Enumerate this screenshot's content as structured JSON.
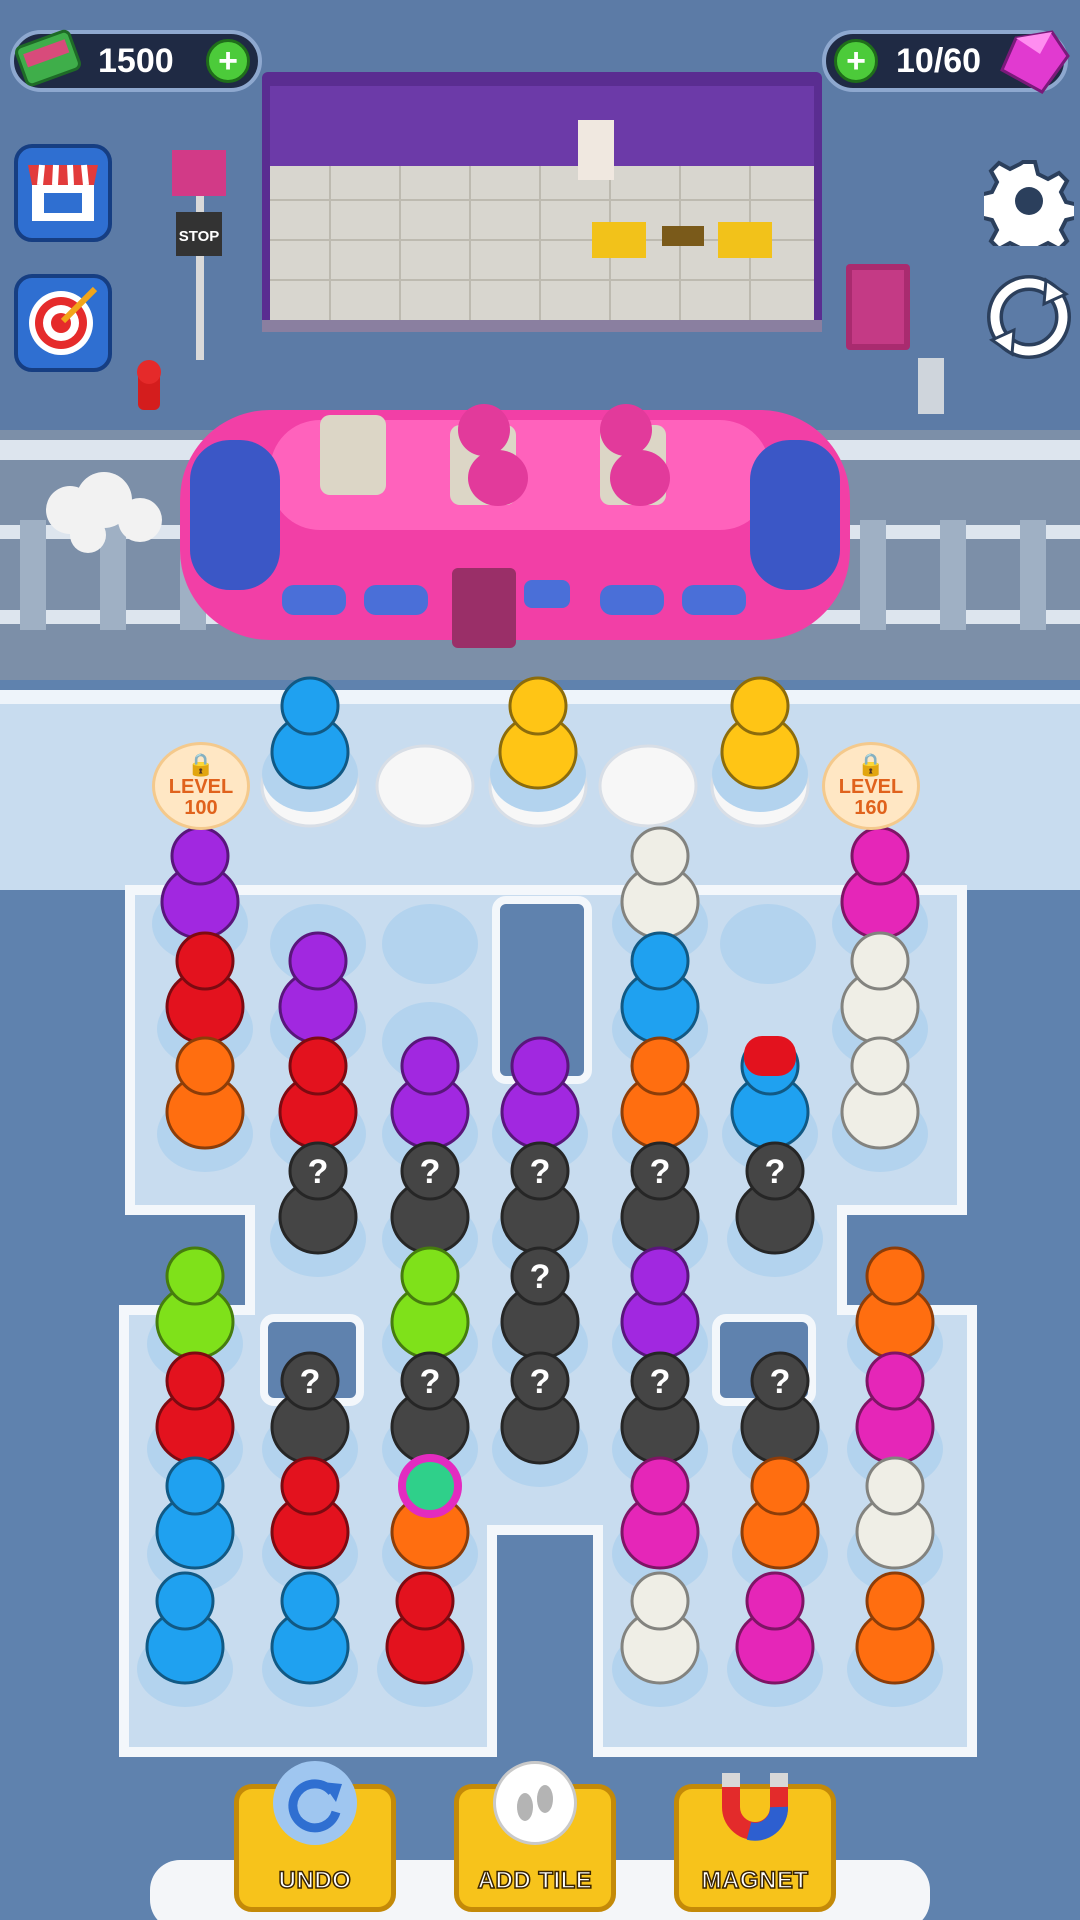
{
  "hud": {
    "cash_amount": "1500",
    "gems_progress": "10/60"
  },
  "map": {
    "stop_sign": "STOP"
  },
  "lots": [
    {
      "label": "LEVEL",
      "value": "100"
    },
    {
      "label": "LEVEL",
      "value": "160"
    }
  ],
  "boosters": {
    "undo_label": "UNDO",
    "add_tile_label": "ADD TILE",
    "magnet_label": "MAGNET"
  },
  "colors": {
    "background": "#5f82ae",
    "board": "#c8dcef",
    "train": "#f23fa6",
    "button_yellow": "#f7c31b"
  },
  "icons": [
    "cash-icon",
    "plus-icon",
    "gem-icon",
    "shop-icon",
    "target-icon",
    "settings-icon",
    "restart-icon",
    "lock-icon",
    "undo-icon",
    "footprints-icon",
    "magnet-icon"
  ]
}
